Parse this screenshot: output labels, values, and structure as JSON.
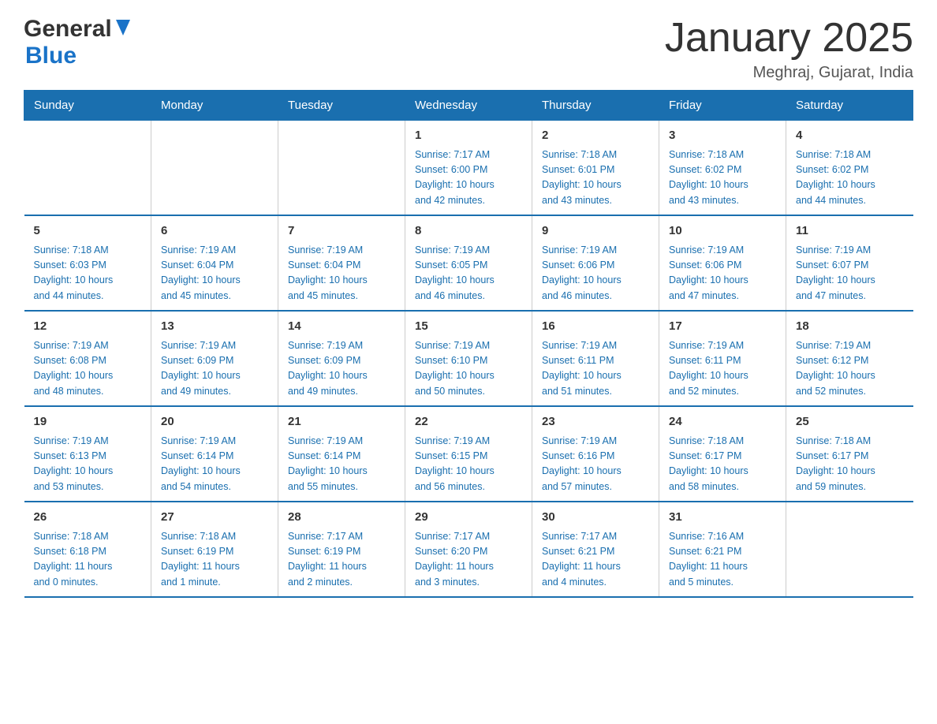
{
  "header": {
    "logo": {
      "general_text": "General",
      "blue_text": "Blue"
    },
    "title": "January 2025",
    "location": "Meghraj, Gujarat, India"
  },
  "calendar": {
    "days_of_week": [
      "Sunday",
      "Monday",
      "Tuesday",
      "Wednesday",
      "Thursday",
      "Friday",
      "Saturday"
    ],
    "weeks": [
      [
        {
          "day": "",
          "info": ""
        },
        {
          "day": "",
          "info": ""
        },
        {
          "day": "",
          "info": ""
        },
        {
          "day": "1",
          "info": "Sunrise: 7:17 AM\nSunset: 6:00 PM\nDaylight: 10 hours\nand 42 minutes."
        },
        {
          "day": "2",
          "info": "Sunrise: 7:18 AM\nSunset: 6:01 PM\nDaylight: 10 hours\nand 43 minutes."
        },
        {
          "day": "3",
          "info": "Sunrise: 7:18 AM\nSunset: 6:02 PM\nDaylight: 10 hours\nand 43 minutes."
        },
        {
          "day": "4",
          "info": "Sunrise: 7:18 AM\nSunset: 6:02 PM\nDaylight: 10 hours\nand 44 minutes."
        }
      ],
      [
        {
          "day": "5",
          "info": "Sunrise: 7:18 AM\nSunset: 6:03 PM\nDaylight: 10 hours\nand 44 minutes."
        },
        {
          "day": "6",
          "info": "Sunrise: 7:19 AM\nSunset: 6:04 PM\nDaylight: 10 hours\nand 45 minutes."
        },
        {
          "day": "7",
          "info": "Sunrise: 7:19 AM\nSunset: 6:04 PM\nDaylight: 10 hours\nand 45 minutes."
        },
        {
          "day": "8",
          "info": "Sunrise: 7:19 AM\nSunset: 6:05 PM\nDaylight: 10 hours\nand 46 minutes."
        },
        {
          "day": "9",
          "info": "Sunrise: 7:19 AM\nSunset: 6:06 PM\nDaylight: 10 hours\nand 46 minutes."
        },
        {
          "day": "10",
          "info": "Sunrise: 7:19 AM\nSunset: 6:06 PM\nDaylight: 10 hours\nand 47 minutes."
        },
        {
          "day": "11",
          "info": "Sunrise: 7:19 AM\nSunset: 6:07 PM\nDaylight: 10 hours\nand 47 minutes."
        }
      ],
      [
        {
          "day": "12",
          "info": "Sunrise: 7:19 AM\nSunset: 6:08 PM\nDaylight: 10 hours\nand 48 minutes."
        },
        {
          "day": "13",
          "info": "Sunrise: 7:19 AM\nSunset: 6:09 PM\nDaylight: 10 hours\nand 49 minutes."
        },
        {
          "day": "14",
          "info": "Sunrise: 7:19 AM\nSunset: 6:09 PM\nDaylight: 10 hours\nand 49 minutes."
        },
        {
          "day": "15",
          "info": "Sunrise: 7:19 AM\nSunset: 6:10 PM\nDaylight: 10 hours\nand 50 minutes."
        },
        {
          "day": "16",
          "info": "Sunrise: 7:19 AM\nSunset: 6:11 PM\nDaylight: 10 hours\nand 51 minutes."
        },
        {
          "day": "17",
          "info": "Sunrise: 7:19 AM\nSunset: 6:11 PM\nDaylight: 10 hours\nand 52 minutes."
        },
        {
          "day": "18",
          "info": "Sunrise: 7:19 AM\nSunset: 6:12 PM\nDaylight: 10 hours\nand 52 minutes."
        }
      ],
      [
        {
          "day": "19",
          "info": "Sunrise: 7:19 AM\nSunset: 6:13 PM\nDaylight: 10 hours\nand 53 minutes."
        },
        {
          "day": "20",
          "info": "Sunrise: 7:19 AM\nSunset: 6:14 PM\nDaylight: 10 hours\nand 54 minutes."
        },
        {
          "day": "21",
          "info": "Sunrise: 7:19 AM\nSunset: 6:14 PM\nDaylight: 10 hours\nand 55 minutes."
        },
        {
          "day": "22",
          "info": "Sunrise: 7:19 AM\nSunset: 6:15 PM\nDaylight: 10 hours\nand 56 minutes."
        },
        {
          "day": "23",
          "info": "Sunrise: 7:19 AM\nSunset: 6:16 PM\nDaylight: 10 hours\nand 57 minutes."
        },
        {
          "day": "24",
          "info": "Sunrise: 7:18 AM\nSunset: 6:17 PM\nDaylight: 10 hours\nand 58 minutes."
        },
        {
          "day": "25",
          "info": "Sunrise: 7:18 AM\nSunset: 6:17 PM\nDaylight: 10 hours\nand 59 minutes."
        }
      ],
      [
        {
          "day": "26",
          "info": "Sunrise: 7:18 AM\nSunset: 6:18 PM\nDaylight: 11 hours\nand 0 minutes."
        },
        {
          "day": "27",
          "info": "Sunrise: 7:18 AM\nSunset: 6:19 PM\nDaylight: 11 hours\nand 1 minute."
        },
        {
          "day": "28",
          "info": "Sunrise: 7:17 AM\nSunset: 6:19 PM\nDaylight: 11 hours\nand 2 minutes."
        },
        {
          "day": "29",
          "info": "Sunrise: 7:17 AM\nSunset: 6:20 PM\nDaylight: 11 hours\nand 3 minutes."
        },
        {
          "day": "30",
          "info": "Sunrise: 7:17 AM\nSunset: 6:21 PM\nDaylight: 11 hours\nand 4 minutes."
        },
        {
          "day": "31",
          "info": "Sunrise: 7:16 AM\nSunset: 6:21 PM\nDaylight: 11 hours\nand 5 minutes."
        },
        {
          "day": "",
          "info": ""
        }
      ]
    ]
  }
}
